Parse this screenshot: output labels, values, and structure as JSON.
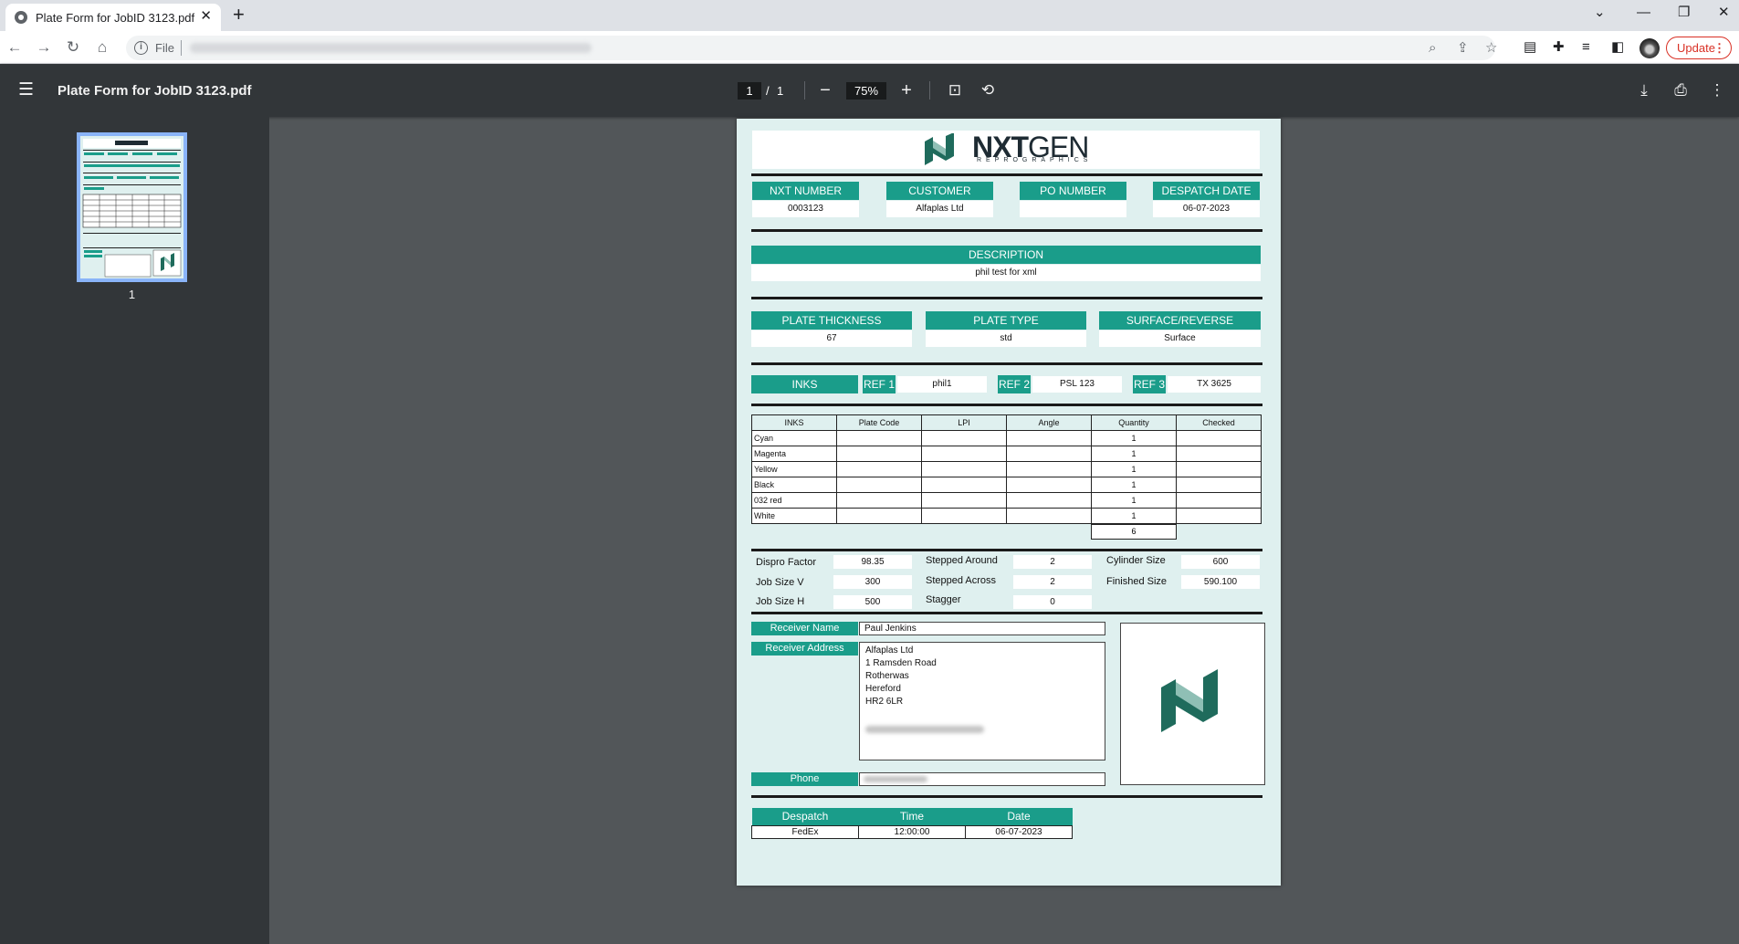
{
  "browser": {
    "tab_title": "Plate Form for JobID 3123.pdf",
    "omnibox_scheme": "File",
    "update_label": "Update"
  },
  "viewer": {
    "title": "Plate Form for JobID 3123.pdf",
    "current_page": "1",
    "page_separator": "/",
    "total_pages": "1",
    "zoom": "75%",
    "thumbnail_label": "1"
  },
  "document": {
    "logo": {
      "bold": "NXT",
      "regular": "GEN",
      "sub": "REPROGRAPHICS"
    },
    "header_fields": [
      {
        "label": "NXT NUMBER",
        "value": "0003123"
      },
      {
        "label": "CUSTOMER",
        "value": "Alfaplas Ltd"
      },
      {
        "label": "PO NUMBER",
        "value": ""
      },
      {
        "label": "DESPATCH DATE",
        "value": "06-07-2023"
      }
    ],
    "description": {
      "label": "DESCRIPTION",
      "value": "phil test for xml"
    },
    "plate_fields": [
      {
        "label": "PLATE THICKNESS",
        "value": "67"
      },
      {
        "label": "PLATE TYPE",
        "value": "std"
      },
      {
        "label": "SURFACE/REVERSE",
        "value": "Surface"
      }
    ],
    "inks_label": "INKS",
    "refs": [
      {
        "label": "REF 1",
        "value": "phil1"
      },
      {
        "label": "REF 2",
        "value": "PSL 123"
      },
      {
        "label": "REF 3",
        "value": "TX 3625"
      }
    ],
    "ink_table": {
      "columns": [
        "INKS",
        "Plate Code",
        "LPI",
        "Angle",
        "Quantity",
        "Checked"
      ],
      "rows": [
        {
          "name": "Cyan",
          "quantity": "1"
        },
        {
          "name": "Magenta",
          "quantity": "1"
        },
        {
          "name": "Yellow",
          "quantity": "1"
        },
        {
          "name": "Black",
          "quantity": "1"
        },
        {
          "name": "032 red",
          "quantity": "1"
        },
        {
          "name": "White",
          "quantity": "1"
        }
      ],
      "total": "6"
    },
    "specs": {
      "dispro_factor": {
        "label": "Dispro Factor",
        "value": "98.35"
      },
      "job_size_v": {
        "label": "Job Size V",
        "value": "300"
      },
      "job_size_h": {
        "label": "Job Size H",
        "value": "500"
      },
      "stepped_around": {
        "label": "Stepped Around",
        "value": "2"
      },
      "stepped_across": {
        "label": "Stepped Across",
        "value": "2"
      },
      "stagger": {
        "label": "Stagger",
        "value": "0"
      },
      "cylinder_size": {
        "label": "Cylinder Size",
        "value": "600"
      },
      "finished_size": {
        "label": "Finished Size",
        "value": "590.100"
      }
    },
    "receiver": {
      "name_label": "Receiver Name",
      "name": "Paul Jenkins",
      "address_label": "Receiver Address",
      "address_lines": [
        "Alfaplas Ltd",
        "1 Ramsden Road",
        "Rotherwas",
        "Hereford",
        "HR2 6LR"
      ],
      "phone_label": "Phone"
    },
    "despatch": {
      "columns": [
        "Despatch",
        "Time",
        "Date"
      ],
      "values": [
        "FedEx",
        "12:00:00",
        "06-07-2023"
      ]
    },
    "colors": {
      "teal": "#1a9d8a",
      "page_bg": "#dff0ef",
      "logo_dark": "#1f6b5c",
      "logo_light": "#8fbfb5"
    }
  }
}
